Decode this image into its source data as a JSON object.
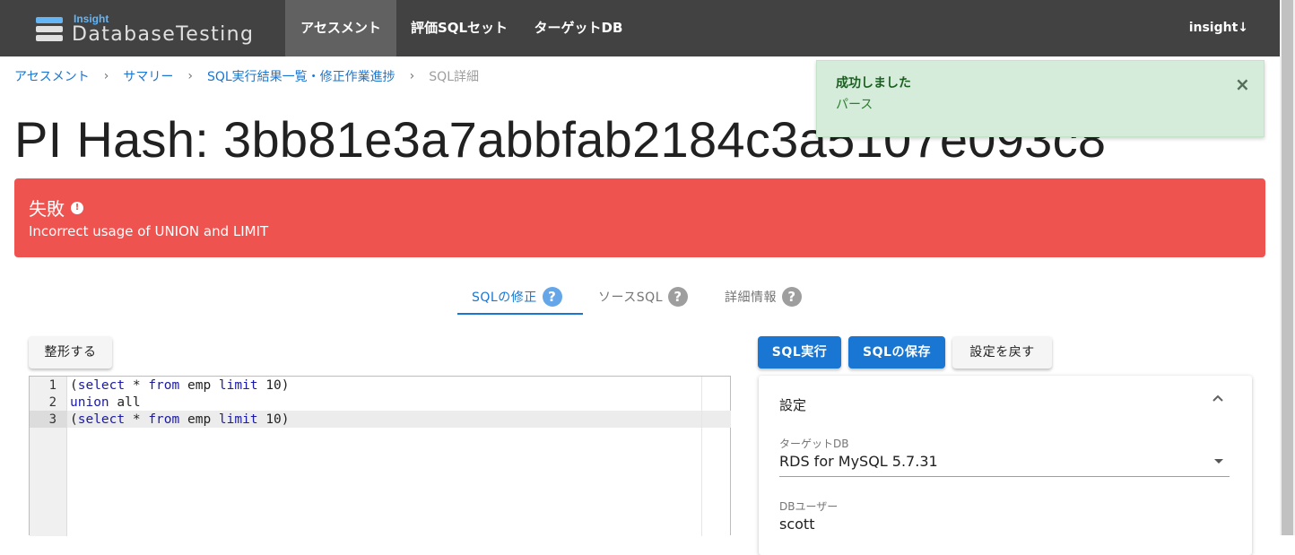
{
  "nav": {
    "logo_small": "Insight",
    "logo_big": "DatabaseTesting",
    "items": [
      "アセスメント",
      "評価SQLセット",
      "ターゲットDB"
    ],
    "user": "insight↓"
  },
  "breadcrumb": [
    "アセスメント",
    "サマリー",
    "SQL実行結果一覧・修正作業進捗",
    "SQL詳細"
  ],
  "breadcrumb_sep": "›",
  "title": "PI Hash: 3bb81e3a7abbfab2184c3a5107e093c8",
  "toast": {
    "title": "成功しました",
    "body": "パース",
    "close": "×"
  },
  "alert": {
    "title": "失敗",
    "icon": "!",
    "message": "Incorrect usage of UNION and LIMIT",
    "color": "#ef5350"
  },
  "tabs": [
    {
      "label": "SQLの修正",
      "icon": "?"
    },
    {
      "label": "ソースSQL",
      "icon": "?"
    },
    {
      "label": "詳細情報",
      "icon": "?"
    }
  ],
  "buttons": {
    "format": "整形する",
    "run": "SQL実行",
    "save": "SQLの保存",
    "reset": "設定を戻す"
  },
  "editor": {
    "line_numbers": [
      "1",
      "2",
      "3"
    ],
    "lines": [
      "(select * from emp limit 10)",
      "union all",
      "(select * from emp limit 10)"
    ]
  },
  "settings": {
    "title": "設定",
    "chevron": "^",
    "target_db_label": "ターゲットDB",
    "target_db_value": "RDS for MySQL 5.7.31",
    "db_user_label": "DBユーザー",
    "db_user_value": "scott"
  },
  "colors": {
    "primary": "#1976d2",
    "nav_bg": "#424242",
    "toast_bg": "#d4ecd9"
  }
}
